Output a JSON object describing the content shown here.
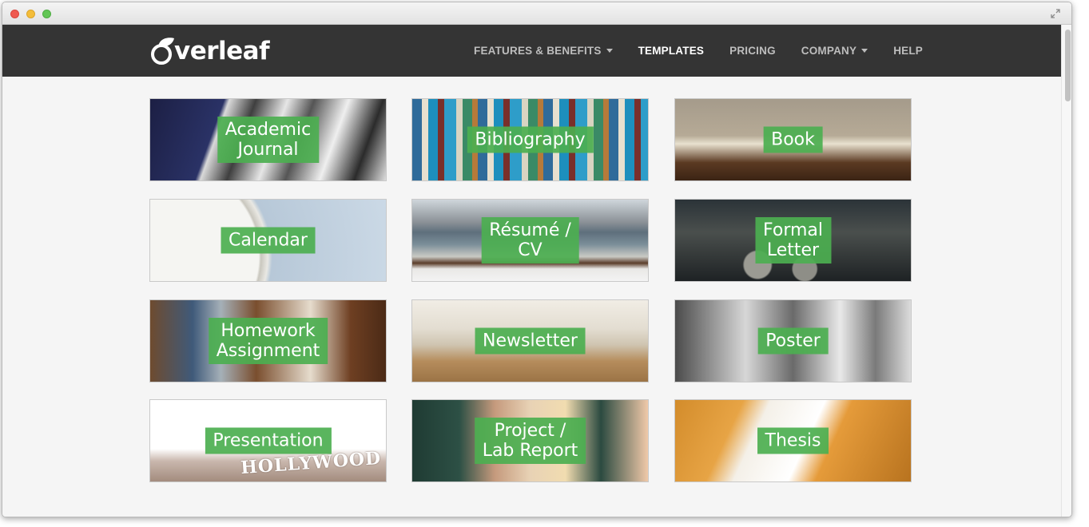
{
  "app": {
    "logo_text": "verleaf"
  },
  "nav": {
    "items": [
      {
        "label": "FEATURES & BENEFITS",
        "dropdown": true,
        "active": false
      },
      {
        "label": "TEMPLATES",
        "dropdown": false,
        "active": true
      },
      {
        "label": "PRICING",
        "dropdown": false,
        "active": false
      },
      {
        "label": "COMPANY",
        "dropdown": true,
        "active": false
      },
      {
        "label": "HELP",
        "dropdown": false,
        "active": false
      }
    ]
  },
  "templates": {
    "cards": [
      {
        "label": "Academic\nJournal"
      },
      {
        "label": "Bibliography"
      },
      {
        "label": "Book"
      },
      {
        "label": "Calendar"
      },
      {
        "label": "Résumé /\nCV"
      },
      {
        "label": "Formal\nLetter"
      },
      {
        "label": "Homework\nAssignment"
      },
      {
        "label": "Newsletter"
      },
      {
        "label": "Poster"
      },
      {
        "label": "Presentation"
      },
      {
        "label": "Project /\nLab Report"
      },
      {
        "label": "Thesis"
      }
    ],
    "hollywood_sign": "HOLLYWOOD"
  },
  "colors": {
    "navbar": "#343434",
    "label_green": "#4caf50",
    "nav_active": "#ffffff",
    "nav_inactive": "#bdbdbd"
  }
}
